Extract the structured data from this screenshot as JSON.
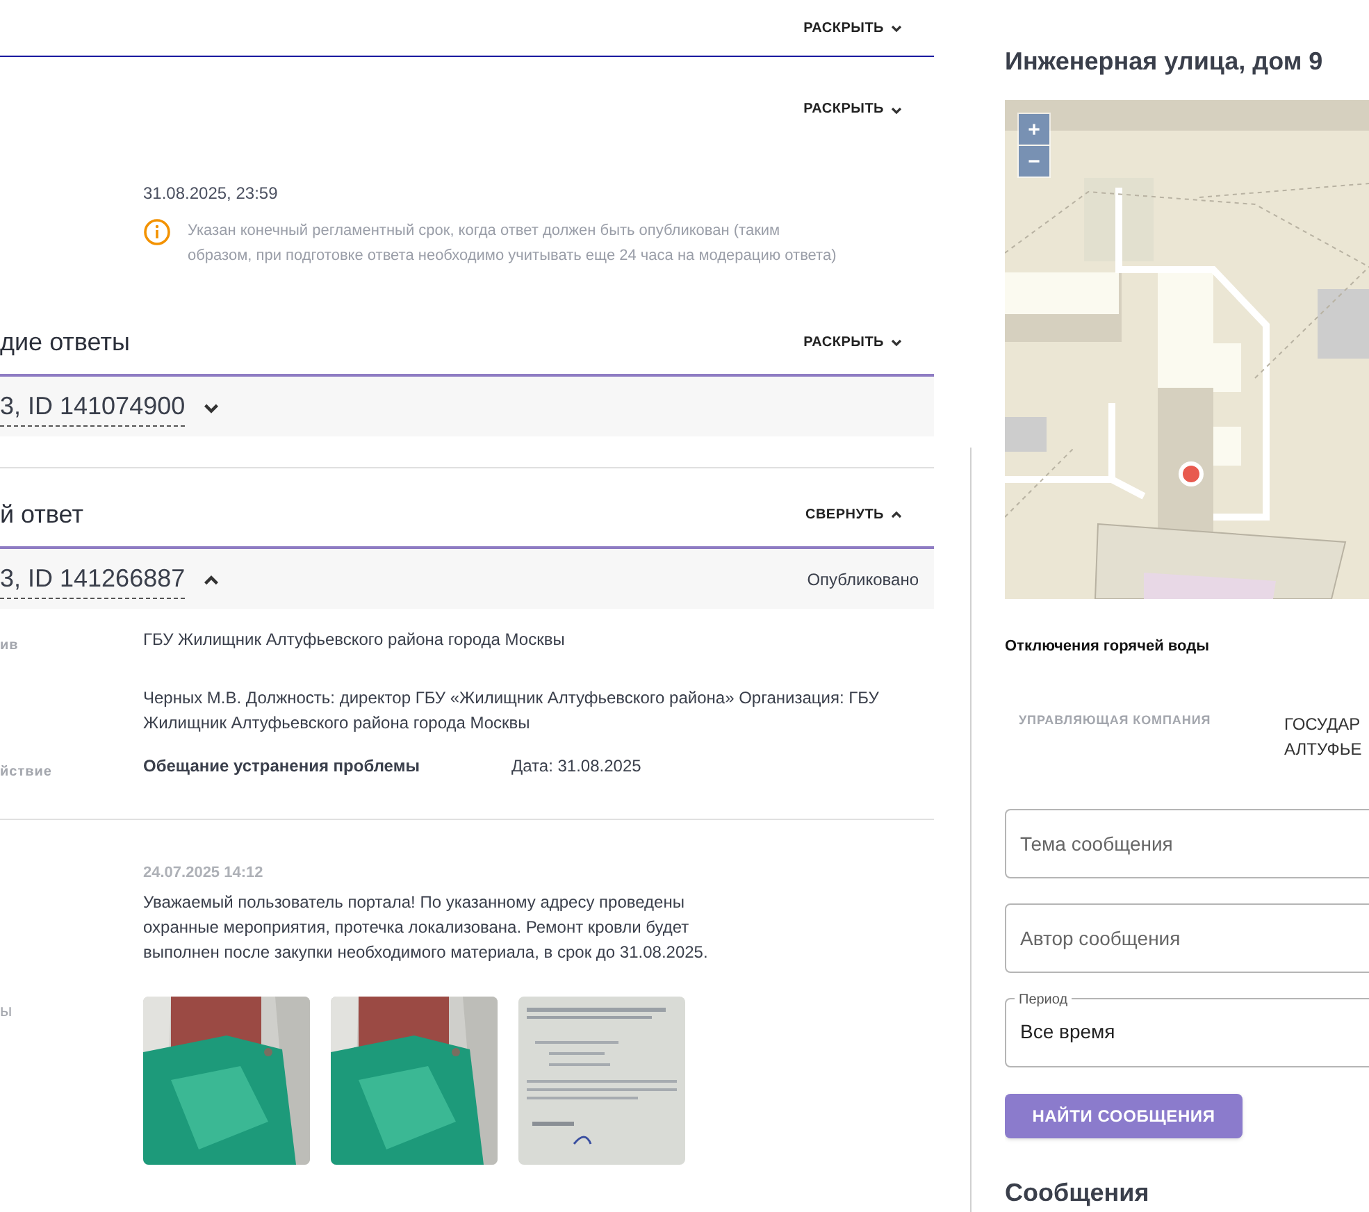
{
  "sections": [
    {
      "kind": "collapsed",
      "toggle": "РАСКРЫТЬ",
      "expanded": false
    },
    {
      "kind": "deadline",
      "toggle": "РАСКРЫТЬ",
      "expanded": false,
      "date": "31.08.2025, 23:59",
      "note": "Указан конечный регламентный срок, когда ответ должен быть опубликован (таким образом, при подготовке ответа необходимо учитывать еще 24 часа на модерацию ответа)"
    },
    {
      "kind": "answers",
      "title": "дие ответы",
      "toggle": "РАСКРЫТЬ",
      "expanded": false,
      "item": {
        "id": "3, ID 141074900",
        "expanded": false
      }
    },
    {
      "kind": "answer",
      "title": "й ответ",
      "toggle": "СВЕРНУТЬ",
      "expanded": true,
      "item": {
        "id": "3, ID 141266887",
        "expanded": true,
        "status": "Опубликовано"
      },
      "rows": [
        {
          "label": "ив",
          "value": "ГБУ Жилищник Алтуфьевского района города Москвы"
        },
        {
          "label": "",
          "value": "Черных М.В. Должность: директор ГБУ «Жилищник Алтуфьевского района» Организация: ГБУ Жилищник Алтуфьевского района города Москвы"
        },
        {
          "label": "йствие",
          "value": "Обещание устранения проблемы",
          "extra": "Дата: 31.08.2025"
        }
      ],
      "reply": {
        "date": "24.07.2025 14:12",
        "text": "Уважаемый пользователь портала! По указанному адресу проведены охранные мероприятия, протечка локализована. Ремонт кровли будет выполнен после закупки необходимого материала, в срок до 31.08.2025.",
        "label": "ы",
        "photos": [
          {
            "kind": "picture"
          },
          {
            "kind": "picture"
          },
          {
            "kind": "document"
          }
        ]
      }
    }
  ],
  "sidebar": {
    "title": "Инженерная улица, дом 9",
    "zoom_in": "+",
    "zoom_out": "−",
    "subtitle": "Отключения горячей воды",
    "company_label": "УПРАВЛЯЮЩАЯ КОМПАНИЯ",
    "company_value": [
      "ГОСУДАР",
      "АЛТУФЬЕ"
    ],
    "fields": [
      {
        "placeholder": "Тема сообщения"
      },
      {
        "placeholder": "Автор сообщения"
      },
      {
        "legend": "Период",
        "value": "Все время"
      }
    ],
    "button": "НАЙТИ СООБЩЕНИЯ",
    "messages_title": "Сообщения"
  }
}
